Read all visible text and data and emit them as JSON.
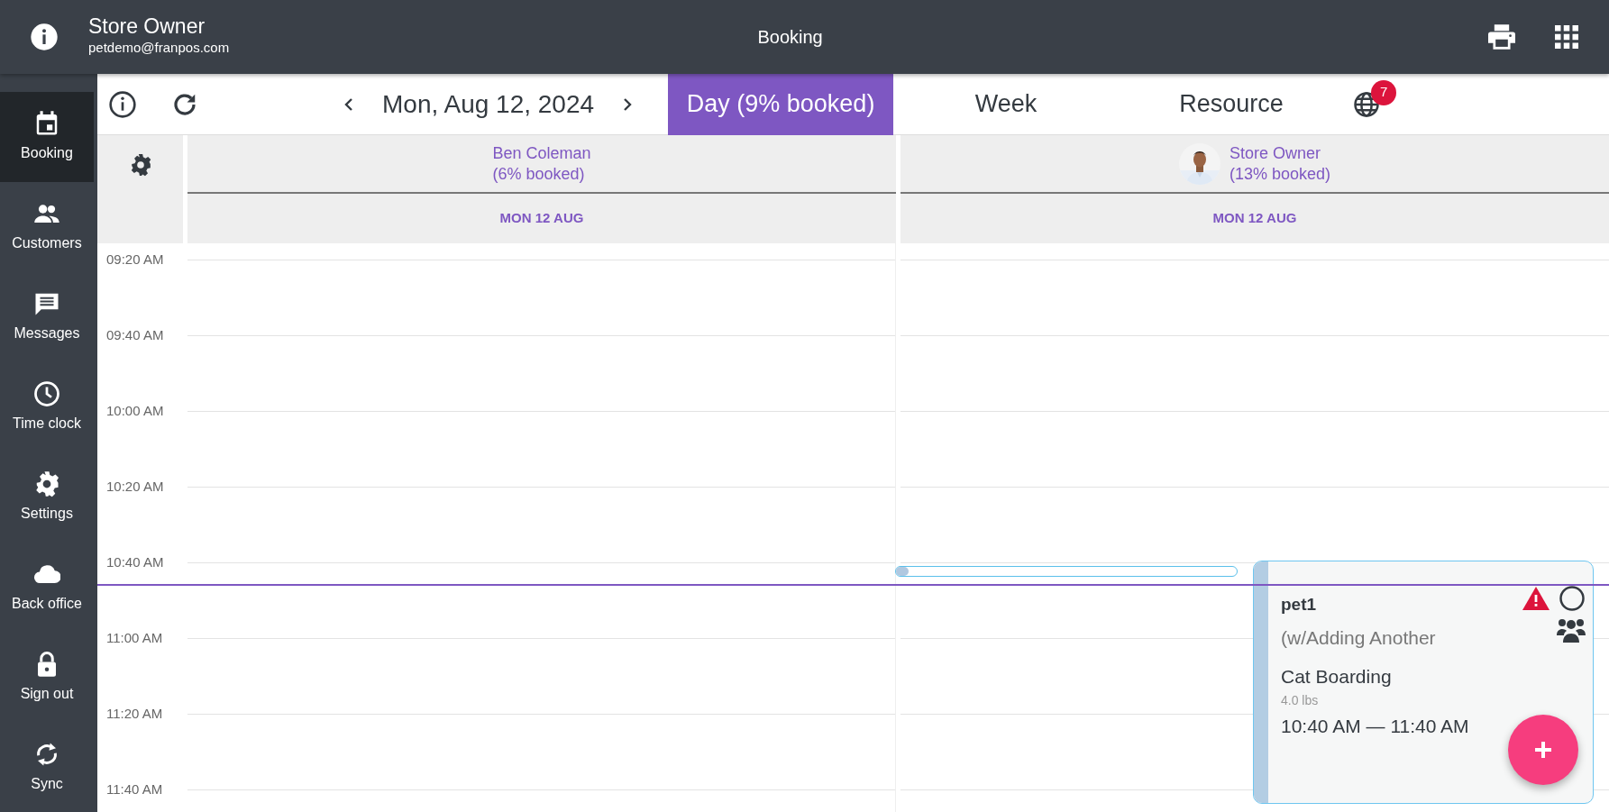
{
  "header": {
    "user_name": "Store Owner",
    "user_email": "petdemo@franpos.com",
    "title": "Booking"
  },
  "sidebar": {
    "items": [
      {
        "label": "Booking",
        "kind": "calendar",
        "selected": true
      },
      {
        "label": "Customers",
        "kind": "people",
        "selected": false
      },
      {
        "label": "Messages",
        "kind": "chat",
        "selected": false
      },
      {
        "label": "Time clock",
        "kind": "clock",
        "selected": false
      },
      {
        "label": "Settings",
        "kind": "gear",
        "selected": false
      },
      {
        "label": "Back office",
        "kind": "cloud",
        "selected": false
      },
      {
        "label": "Sign out",
        "kind": "lock",
        "selected": false
      },
      {
        "label": "Sync",
        "kind": "sync",
        "selected": false
      }
    ]
  },
  "toolbar": {
    "date": "Mon, Aug 12, 2024",
    "views": [
      {
        "label": "Day (9% booked)",
        "selected": true
      },
      {
        "label": "Week",
        "selected": false
      },
      {
        "label": "Resource",
        "selected": false
      }
    ],
    "notification_count": "7"
  },
  "resources": [
    {
      "name": "Ben Coleman",
      "booked": "(6% booked)",
      "date": "MON 12 AUG",
      "avatar": false
    },
    {
      "name": "Store Owner",
      "booked": "(13% booked)",
      "date": "MON 12 AUG",
      "avatar": true
    }
  ],
  "times": [
    "09:20 AM",
    "09:40 AM",
    "10:00 AM",
    "10:20 AM",
    "10:40 AM",
    "11:00 AM",
    "11:20 AM",
    "11:40 AM"
  ],
  "booking": {
    "pet": "pet1",
    "note": "(w/Adding Another",
    "service": "Cat Boarding",
    "weight": "4.0 lbs",
    "time": "10:40 AM — 11:40 AM",
    "warning": true,
    "checked": false,
    "group": true
  }
}
